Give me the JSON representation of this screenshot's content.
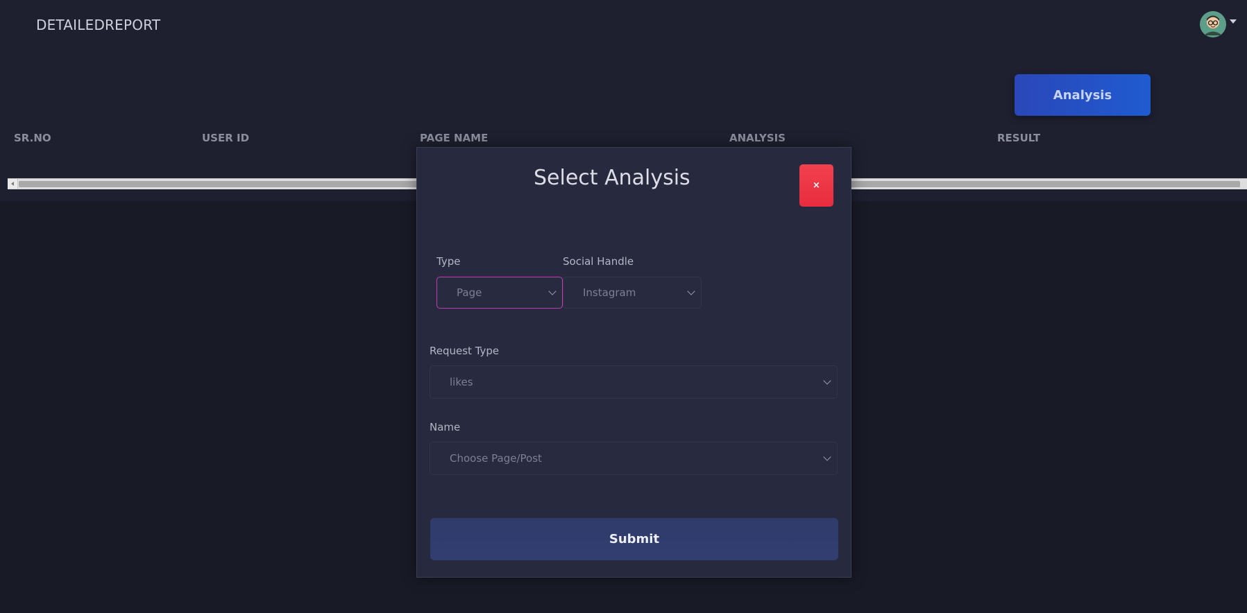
{
  "app": {
    "brand": "DETAILEDREPORT"
  },
  "header": {
    "analysis_button": "Analysis"
  },
  "table": {
    "columns": [
      "SR.NO",
      "USER ID",
      "PAGE NAME",
      "ANALYSIS",
      "RESULT"
    ]
  },
  "modal": {
    "title": "Select Analysis",
    "close_label": "×",
    "type": {
      "label": "Type",
      "value": "Page"
    },
    "social_handle": {
      "label": "Social Handle",
      "value": "Instagram"
    },
    "request_type": {
      "label": "Request Type",
      "value": "likes"
    },
    "name": {
      "label": "Name",
      "value": "Choose Page/Post"
    },
    "submit_label": "Submit"
  },
  "icons": {
    "avatar": "user-avatar-icon",
    "caret": "caret-down-icon",
    "close": "close-icon",
    "chevron": "chevron-down-icon"
  },
  "colors": {
    "page_bg": "#181a26",
    "topbar_bg": "#1e2030",
    "modal_bg": "#272a3e",
    "accent_blue": "#2a47b9",
    "close_red": "#e72d3d",
    "focus_magenta": "#c93bb5",
    "submit_bg": "#323e71"
  }
}
